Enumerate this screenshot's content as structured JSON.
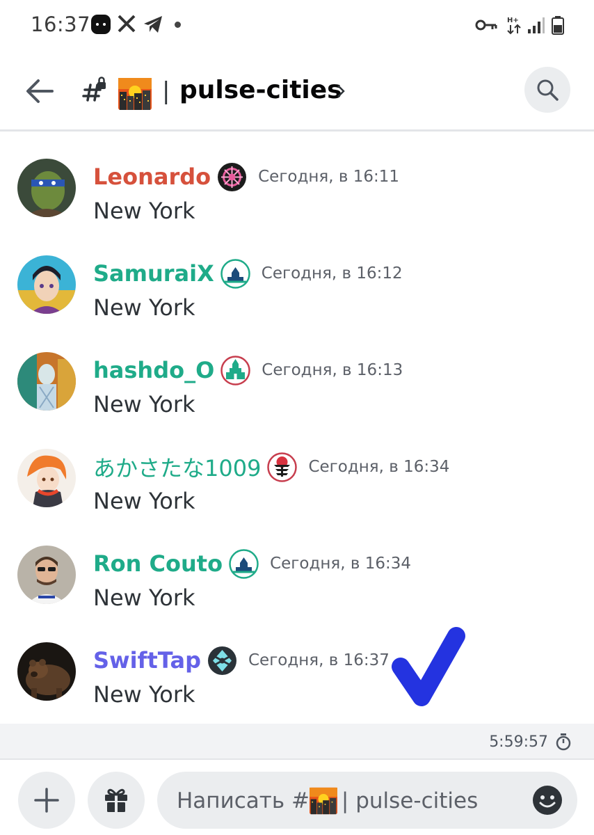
{
  "status_bar": {
    "time": "16:37",
    "icons": [
      "app-notification-icon",
      "x-app-icon",
      "telegram-icon",
      "vpn-key-icon",
      "network-type-icon",
      "signal-icon",
      "battery-icon"
    ]
  },
  "header": {
    "channel_name": "pulse-cities",
    "separator": "|",
    "channel_emoji": "night-city-emoji"
  },
  "messages": [
    {
      "username": "Leonardo",
      "color": "#d6513c",
      "badge": "pink-emblem-badge",
      "timestamp": "Сегодня, в 16:11",
      "text": "New York"
    },
    {
      "username": "SamuraiX",
      "color": "#1fab89",
      "badge": "city-emblem-badge",
      "timestamp": "Сегодня, в 16:12",
      "text": "New York"
    },
    {
      "username": "hashdo_O",
      "color": "#1fab89",
      "badge": "kremlin-emblem-badge",
      "timestamp": "Сегодня, в 16:13",
      "text": "New York"
    },
    {
      "username": "あかさたな1009",
      "color": "#1fab89",
      "badge": "pagoda-emblem-badge",
      "timestamp": "Сегодня, в 16:34",
      "text": "New York"
    },
    {
      "username": "Ron Couto",
      "color": "#1fab89",
      "badge": "city-emblem-badge",
      "timestamp": "Сегодня, в 16:34",
      "text": "New York"
    },
    {
      "username": "SwiftTap",
      "color": "#6461e8",
      "badge": "crystal-emblem-badge",
      "timestamp": "Сегодня, в 16:37",
      "text": "New York"
    }
  ],
  "slowmode": {
    "time": "5:59:57"
  },
  "composer": {
    "placeholder_prefix": "Написать #",
    "placeholder_suffix": "| pulse-cities"
  },
  "colors": {
    "checkmark": "#2433e0",
    "accent_green": "#1fab89"
  }
}
